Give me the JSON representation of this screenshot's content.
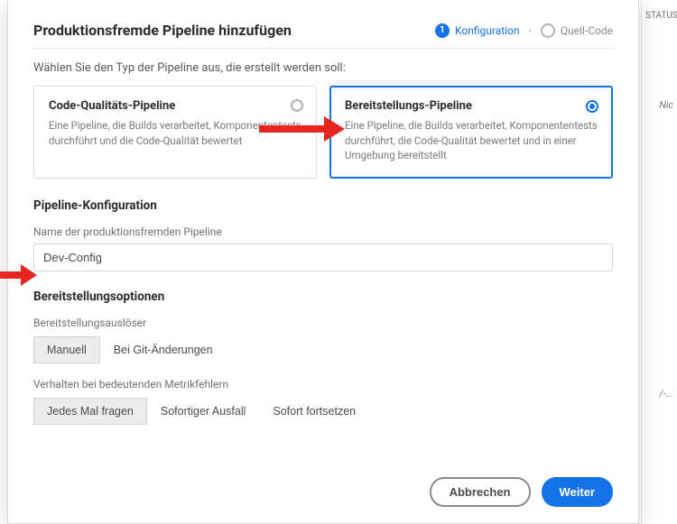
{
  "background": {
    "statusHeader": "STATUS",
    "rightText1": "Nic",
    "rightText2": "/-..."
  },
  "modal": {
    "title": "Produktionsfremde Pipeline hinzufügen",
    "stepper": {
      "step1": {
        "num": "1",
        "label": "Konfiguration"
      },
      "step2": {
        "label": "Quell-Code"
      }
    },
    "prompt": "Wählen Sie den Typ der Pipeline aus, die erstellt werden soll:",
    "cards": {
      "quality": {
        "title": "Code-Qualitäts-Pipeline",
        "desc": "Eine Pipeline, die Builds verarbeitet, Komponententests durchführt und die Code-Qualität bewertet"
      },
      "deploy": {
        "title": "Bereitstellungs-Pipeline",
        "desc": "Eine Pipeline, die Builds verarbeitet, Komponententests durchführt, die Code-Qualität bewertet und in einer Umgebung bereitstellt"
      }
    },
    "config": {
      "heading": "Pipeline-Konfiguration",
      "nameLabel": "Name der produktionsfremden Pipeline",
      "nameValue": "Dev-Config"
    },
    "deployOptions": {
      "heading": "Bereitstellungsoptionen",
      "triggerLabel": "Bereitstellungsauslöser",
      "triggerOptions": {
        "manual": "Manuell",
        "git": "Bei Git-Änderungen"
      },
      "metricLabel": "Verhalten bei bedeutenden Metrikfehlern",
      "metricOptions": {
        "ask": "Jedes Mal fragen",
        "fail": "Sofortiger Ausfall",
        "continue": "Sofort fortsetzen"
      }
    },
    "footer": {
      "cancel": "Abbrechen",
      "next": "Weiter"
    }
  }
}
